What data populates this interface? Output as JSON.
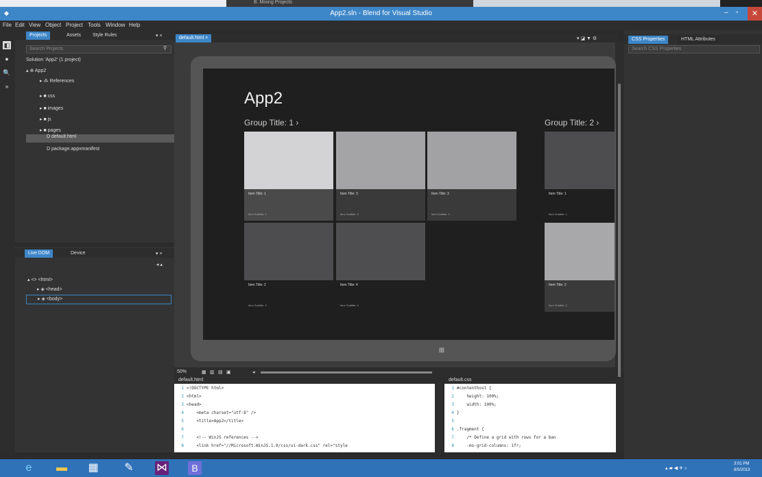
{
  "background_strip": {
    "text": "B. Mixing Projects"
  },
  "window": {
    "title": "App2.sln - Blend for Visual Studio",
    "min": "–",
    "max": "▫",
    "close": "✕",
    "icon": "◆"
  },
  "menu": [
    "File",
    "Edit",
    "View",
    "Object",
    "Project",
    "Tools",
    "Window",
    "Help"
  ],
  "tools": [
    "◧",
    "●",
    "🔍",
    "»"
  ],
  "projects_panel": {
    "tabs": [
      "Projects",
      "Assets",
      "Style Rules"
    ],
    "pin": "▾ ×",
    "search_placeholder": "Search Projects",
    "search_icon": "⚲",
    "tree": [
      {
        "label": "Solution 'App2' (1 project)"
      },
      {
        "label": "▴ ⊕ App2"
      },
      {
        "label": "▸ ⁂ References"
      },
      {
        "label": "▸ ■ css"
      },
      {
        "label": "▸ ■ images"
      },
      {
        "label": "▸ ■ js"
      },
      {
        "label": "▸ ■ pages"
      },
      {
        "label": "D default.html"
      },
      {
        "label": "D package.appxmanifest"
      }
    ]
  },
  "dom_panel": {
    "tabs": [
      "Live DOM",
      "Device"
    ],
    "pin": "▾ ×",
    "tools": "◂ ▴",
    "tree": [
      {
        "label": "▴ <> <html>"
      },
      {
        "label": "▸ ◈ <head>"
      },
      {
        "label": "▸ ◈ <body>"
      }
    ]
  },
  "document_tab": {
    "label": "default.html",
    "close": "×",
    "toolbar": "▾ ◪ ▼ ⚙"
  },
  "artboard": {
    "app_title": "App2",
    "groups": [
      {
        "title": "Group Title: 1 ›"
      },
      {
        "title": "Group Title: 2 ›"
      }
    ],
    "tiles": [
      {
        "title": "Item Title: 1",
        "subtitle": "Item Subtitle: 1",
        "img": "#d3d3d5",
        "cap": "#4a4a4a"
      },
      {
        "title": "Item Title: 3",
        "subtitle": "Item Subtitle: 3",
        "img": "#a4a4a6",
        "cap": "#3a3a3a"
      },
      {
        "title": "Item Title: 3",
        "subtitle": "Item Subtitle: 3",
        "img": "#a2a2a4",
        "cap": "#3a3a3a"
      },
      {
        "title": "Item Title: 2",
        "subtitle": "Item Subtitle: 2",
        "img": "#4d4d4f",
        "cap": "#1f1f1f"
      },
      {
        "title": "Item Title: 4",
        "subtitle": "Item Subtitle: 4",
        "img": "#4e4e50",
        "cap": "#1f1f1f"
      },
      {
        "title": "Item Title: 1",
        "subtitle": "Item Subtitle: 1",
        "img": "#4d4d4f",
        "cap": "#1f1f1f"
      },
      {
        "title": "Item Title: 2",
        "subtitle": "Item Subtitle: 2",
        "img": "#a8a8aa",
        "cap": "#3a3a3a"
      }
    ],
    "home_button": "⊞"
  },
  "zoom": {
    "value": "50%",
    "views": [
      "▦",
      "▥",
      "▤",
      "▣"
    ],
    "slider_icon": "◂"
  },
  "html_editor": {
    "file": "default.html",
    "lines": [
      {
        "n": "1",
        "t": "<!DOCTYPE html>"
      },
      {
        "n": "2",
        "t": "<html>"
      },
      {
        "n": "3",
        "t": "<head>"
      },
      {
        "n": "4",
        "t": "    <meta charset=\"utf-8\" />"
      },
      {
        "n": "5",
        "t": "    <title>App2</title>"
      },
      {
        "n": "6",
        "t": ""
      },
      {
        "n": "7",
        "t": "    <!-- WinJS references -->"
      },
      {
        "n": "8",
        "t": "    <link href=\"//Microsoft.WinJS.1.0/css/ui-dark.css\" rel=\"style"
      }
    ]
  },
  "css_editor": {
    "file": "default.css",
    "lines": [
      {
        "n": "1",
        "t": "#contenthost {"
      },
      {
        "n": "2",
        "t": "    height: 100%;"
      },
      {
        "n": "3",
        "t": "    width: 100%;"
      },
      {
        "n": "4",
        "t": "}"
      },
      {
        "n": "5",
        "t": ""
      },
      {
        "n": "6",
        "t": ".fragment {"
      },
      {
        "n": "7",
        "t": "    /* Define a grid with rows for a ban"
      },
      {
        "n": "8",
        "t": "    -ms-grid-columns: 1fr;"
      }
    ]
  },
  "css_panel": {
    "tabs": [
      "CSS Properties",
      "HTML Attributes"
    ],
    "search_placeholder": "Search CSS Properties"
  },
  "taskbar": {
    "apps": [
      "e",
      "▬",
      "▦",
      "✎",
      "⋈",
      "B"
    ],
    "tray": "▴ ▰ ◀ ✈ ♪",
    "time": "3:01 PM",
    "date": "8/5/2013"
  }
}
